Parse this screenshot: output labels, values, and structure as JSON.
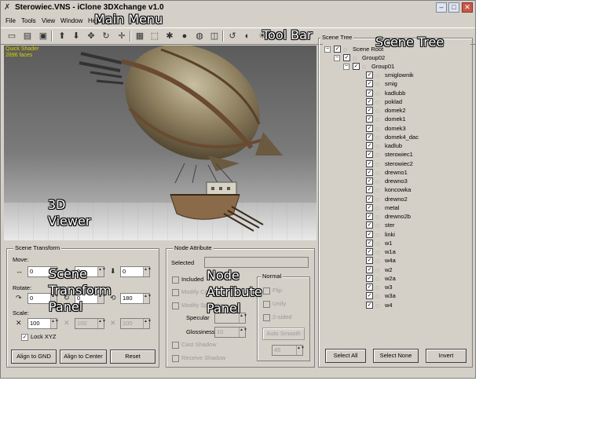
{
  "window": {
    "title": "Sterowiec.VNS - iClone 3DXchange v1.0",
    "buttons": {
      "minimize": "–",
      "maximize": "□",
      "close": "✕"
    }
  },
  "menu": [
    "File",
    "Tools",
    "View",
    "Window",
    "Help"
  ],
  "toolbar": {
    "icons": [
      "open-icon",
      "save-icon",
      "export-icon",
      "move-up-icon",
      "move-down-icon",
      "move-icon",
      "rotate-icon",
      "scale-icon",
      "grid-icon",
      "select-icon",
      "character-icon",
      "sphere-icon",
      "globe-icon",
      "frame-icon",
      "undo-icon",
      "redo-icon",
      "light-icon"
    ]
  },
  "viewer": {
    "shader": "Quick Shader",
    "faces": "2896 faces"
  },
  "scene_transform": {
    "title": "Scene Transform",
    "move_label": "Move:",
    "move": [
      "0",
      "0",
      "0"
    ],
    "rotate_label": "Rotate:",
    "rotate": [
      "0",
      "0",
      "180"
    ],
    "scale_label": "Scale:",
    "scale": [
      "100",
      "100",
      "100"
    ],
    "lock_label": "Lock XYZ",
    "lock_checked": true,
    "buttons": {
      "align_gnd": "Align to GND",
      "align_center": "Align to Center",
      "reset": "Reset"
    }
  },
  "node_attribute": {
    "title": "Node Attribute",
    "selected_label": "Selected",
    "selected_value": "",
    "included": "Included",
    "modify_color": "Modify Color",
    "modify_specular": "Modify Specular",
    "specular_label": "Specular",
    "specular_value": "",
    "glossiness_label": "Glossiness",
    "glossiness_value": "10",
    "cast_shadow": "Cast Shadow",
    "receive_shadow": "Receive Shadow",
    "normal": {
      "title": "Normal",
      "flip": "Flip",
      "unify": "Unify",
      "two_sided": "2-sided",
      "auto_smooth": "Auto Smooth",
      "smooth_value": "45"
    }
  },
  "scene_tree": {
    "title": "Scene Tree",
    "root": "Scene Root",
    "group1": "Group02",
    "group2": "Group01",
    "items": [
      "smiglownik",
      "smig",
      "kadlubb",
      "poklad",
      "domek2",
      "domek1",
      "domek3",
      "domek4_dac",
      "kadlub",
      "sterowiec1",
      "sterowiec2",
      "drewno1",
      "drewno3",
      "koncowka",
      "drewno2",
      "metal",
      "drewno2b",
      "ster",
      "linki",
      "w1",
      "w1a",
      "w4a",
      "w2",
      "w2a",
      "w3",
      "w3a",
      "w4"
    ],
    "buttons": {
      "select_all": "Select All",
      "select_none": "Select None",
      "invert": "Invert"
    }
  },
  "annotations": {
    "main_menu": "Main Menu",
    "tool_bar": "Tool Bar",
    "scene_tree": "Scene Tree",
    "viewer": [
      "3D",
      "Viewer"
    ],
    "scene_transform": [
      "Scene",
      "Transform",
      "Panel"
    ],
    "node_attribute": [
      "Node",
      "Attribute",
      "Panel"
    ]
  }
}
